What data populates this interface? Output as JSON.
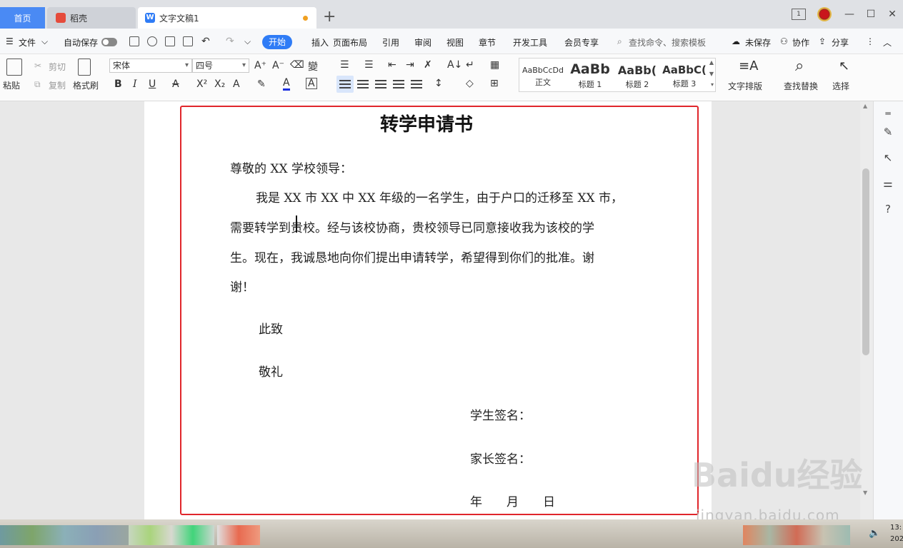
{
  "tabs": {
    "home": "首页",
    "daoke": "稻壳",
    "document": "文字文稿1",
    "screen_badge": "1"
  },
  "menu": {
    "file": "文件",
    "autosave": "自动保存",
    "items": [
      "开始",
      "插入",
      "页面布局",
      "引用",
      "审阅",
      "视图",
      "章节",
      "开发工具",
      "会员专享"
    ],
    "search_placeholder": "查找命令、搜索模板",
    "unsaved": "未保存",
    "collab": "协作",
    "share": "分享"
  },
  "ribbon": {
    "paste": "粘贴",
    "cut": "剪切",
    "copy": "复制",
    "format_painter": "格式刷",
    "font_name": "宋体",
    "font_size": "四号",
    "styles": [
      {
        "sample": "AaBbCcDd",
        "label": "正文"
      },
      {
        "sample": "AaBb",
        "label": "标题 1"
      },
      {
        "sample": "AaBb(",
        "label": "标题 2"
      },
      {
        "sample": "AaBbC(",
        "label": "标题 3"
      }
    ],
    "text_layout": "文字排版",
    "find_replace": "查找替换",
    "select": "选择"
  },
  "document": {
    "title": "转学申请书",
    "salutation": "尊敬的 XX 学校领导：",
    "body_lines": [
      "我是 XX 市 XX 中 XX 年级的一名学生，由于户口的迁移至 XX 市，",
      "需要转学到贵校。经与该校协商，贵校领导已同意接收我为该校的学",
      "生。现在，我诚恳地向你们提出申请转学，希望得到你们的批准。谢",
      "谢！"
    ],
    "closing1": "此致",
    "closing2": "敬礼",
    "student_sign": "学生签名：",
    "parent_sign": "家长签名：",
    "date": "年　　月　　日"
  },
  "watermark": {
    "brand": "Baidu经验",
    "url": "jingyan.baidu.com"
  },
  "taskbar": {
    "clock_line1": "13:",
    "clock_line2": "202"
  },
  "colors": {
    "accent": "#2f7cf6",
    "highlight_border": "#e0262b"
  }
}
